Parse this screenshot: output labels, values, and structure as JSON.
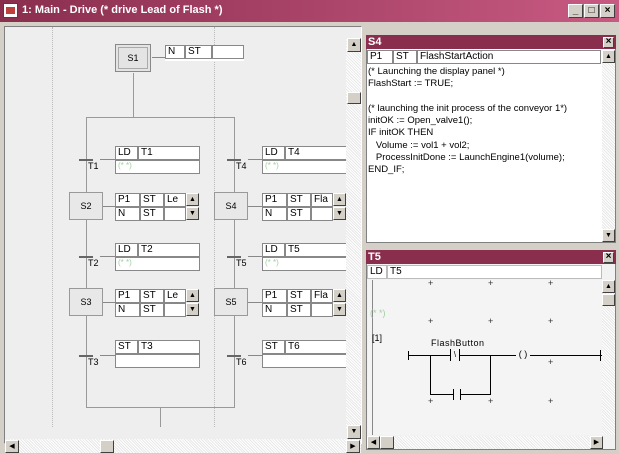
{
  "window": {
    "title": "1: Main - Drive (* drive Lead of Flash *)",
    "minimize": "_",
    "maximize": "□",
    "close": "×"
  },
  "sfc": {
    "initial_step": {
      "name": "S1",
      "action": {
        "qualifier": "N",
        "lang": "ST"
      }
    },
    "steps": [
      {
        "name": "S2",
        "rows": [
          {
            "q": "P1",
            "lang": "ST",
            "act": "Le"
          },
          {
            "q": "N",
            "lang": "ST"
          }
        ]
      },
      {
        "name": "S3",
        "rows": [
          {
            "q": "P1",
            "lang": "ST",
            "act": "Le"
          },
          {
            "q": "N",
            "lang": "ST"
          }
        ]
      },
      {
        "name": "S4",
        "rows": [
          {
            "q": "P1",
            "lang": "ST",
            "act": "Fla"
          },
          {
            "q": "N",
            "lang": "ST"
          }
        ]
      },
      {
        "name": "S5",
        "rows": [
          {
            "q": "P1",
            "lang": "ST",
            "act": "Fla"
          },
          {
            "q": "N",
            "lang": "ST"
          }
        ]
      }
    ],
    "transitions": [
      {
        "name": "T1",
        "lang": "LD",
        "label": "T1",
        "comment": "(* *)"
      },
      {
        "name": "T2",
        "lang": "LD",
        "label": "T2",
        "comment": "(* *)"
      },
      {
        "name": "T3",
        "lang": "ST",
        "label": "T3"
      },
      {
        "name": "T4",
        "lang": "LD",
        "label": "T4",
        "comment": "(* *)"
      },
      {
        "name": "T5",
        "lang": "LD",
        "label": "T5",
        "comment": "(* *)"
      },
      {
        "name": "T6",
        "lang": "ST",
        "label": "T6"
      }
    ]
  },
  "s4_panel": {
    "title": "S4",
    "close": "×",
    "header": {
      "q": "P1",
      "lang": "ST",
      "action": "FlashStartAction"
    },
    "code": [
      "(* Launching the display panel *)",
      "FlashStart := TRUE;",
      "",
      "(* launching the init process of the conveyor 1*)",
      "initOK := Open_valve1();",
      "IF initOK THEN",
      "   Volume := vol1 + vol2;",
      "   ProcessInitDone := LaunchEngine1(volume);",
      "END_IF;"
    ]
  },
  "t5_panel": {
    "title": "T5",
    "close": "×",
    "header": {
      "lang": "LD",
      "name": "T5"
    },
    "comment": "(* *)",
    "rung": "[1]",
    "contact": "FlashButton"
  },
  "colors": {
    "title_bar": "#8a2e4e",
    "panel_bg": "#eeeeee",
    "faint_comment": "#9fd09f"
  }
}
